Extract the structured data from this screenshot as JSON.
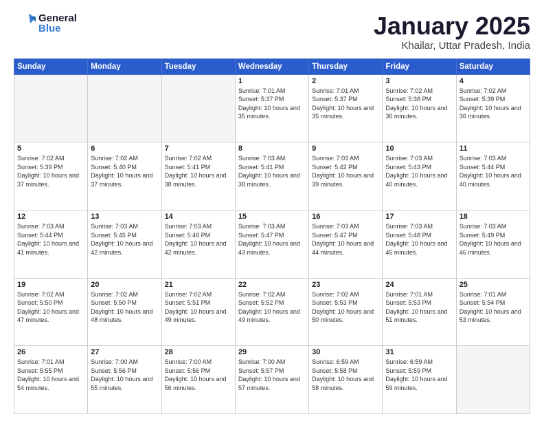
{
  "header": {
    "logo_general": "General",
    "logo_blue": "Blue",
    "title": "January 2025",
    "subtitle": "Khailar, Uttar Pradesh, India"
  },
  "weekdays": [
    "Sunday",
    "Monday",
    "Tuesday",
    "Wednesday",
    "Thursday",
    "Friday",
    "Saturday"
  ],
  "weeks": [
    [
      {
        "day": "",
        "empty": true
      },
      {
        "day": "",
        "empty": true
      },
      {
        "day": "",
        "empty": true
      },
      {
        "day": "1",
        "sunrise": "7:01 AM",
        "sunset": "5:37 PM",
        "daylight": "10 hours and 35 minutes."
      },
      {
        "day": "2",
        "sunrise": "7:01 AM",
        "sunset": "5:37 PM",
        "daylight": "10 hours and 35 minutes."
      },
      {
        "day": "3",
        "sunrise": "7:02 AM",
        "sunset": "5:38 PM",
        "daylight": "10 hours and 36 minutes."
      },
      {
        "day": "4",
        "sunrise": "7:02 AM",
        "sunset": "5:39 PM",
        "daylight": "10 hours and 36 minutes."
      }
    ],
    [
      {
        "day": "5",
        "sunrise": "7:02 AM",
        "sunset": "5:39 PM",
        "daylight": "10 hours and 37 minutes."
      },
      {
        "day": "6",
        "sunrise": "7:02 AM",
        "sunset": "5:40 PM",
        "daylight": "10 hours and 37 minutes."
      },
      {
        "day": "7",
        "sunrise": "7:02 AM",
        "sunset": "5:41 PM",
        "daylight": "10 hours and 38 minutes."
      },
      {
        "day": "8",
        "sunrise": "7:03 AM",
        "sunset": "5:41 PM",
        "daylight": "10 hours and 38 minutes."
      },
      {
        "day": "9",
        "sunrise": "7:03 AM",
        "sunset": "5:42 PM",
        "daylight": "10 hours and 39 minutes."
      },
      {
        "day": "10",
        "sunrise": "7:03 AM",
        "sunset": "5:43 PM",
        "daylight": "10 hours and 40 minutes."
      },
      {
        "day": "11",
        "sunrise": "7:03 AM",
        "sunset": "5:44 PM",
        "daylight": "10 hours and 40 minutes."
      }
    ],
    [
      {
        "day": "12",
        "sunrise": "7:03 AM",
        "sunset": "5:44 PM",
        "daylight": "10 hours and 41 minutes."
      },
      {
        "day": "13",
        "sunrise": "7:03 AM",
        "sunset": "5:45 PM",
        "daylight": "10 hours and 42 minutes."
      },
      {
        "day": "14",
        "sunrise": "7:03 AM",
        "sunset": "5:46 PM",
        "daylight": "10 hours and 42 minutes."
      },
      {
        "day": "15",
        "sunrise": "7:03 AM",
        "sunset": "5:47 PM",
        "daylight": "10 hours and 43 minutes."
      },
      {
        "day": "16",
        "sunrise": "7:03 AM",
        "sunset": "5:47 PM",
        "daylight": "10 hours and 44 minutes."
      },
      {
        "day": "17",
        "sunrise": "7:03 AM",
        "sunset": "5:48 PM",
        "daylight": "10 hours and 45 minutes."
      },
      {
        "day": "18",
        "sunrise": "7:03 AM",
        "sunset": "5:49 PM",
        "daylight": "10 hours and 46 minutes."
      }
    ],
    [
      {
        "day": "19",
        "sunrise": "7:02 AM",
        "sunset": "5:50 PM",
        "daylight": "10 hours and 47 minutes."
      },
      {
        "day": "20",
        "sunrise": "7:02 AM",
        "sunset": "5:50 PM",
        "daylight": "10 hours and 48 minutes."
      },
      {
        "day": "21",
        "sunrise": "7:02 AM",
        "sunset": "5:51 PM",
        "daylight": "10 hours and 49 minutes."
      },
      {
        "day": "22",
        "sunrise": "7:02 AM",
        "sunset": "5:52 PM",
        "daylight": "10 hours and 49 minutes."
      },
      {
        "day": "23",
        "sunrise": "7:02 AM",
        "sunset": "5:53 PM",
        "daylight": "10 hours and 50 minutes."
      },
      {
        "day": "24",
        "sunrise": "7:01 AM",
        "sunset": "5:53 PM",
        "daylight": "10 hours and 51 minutes."
      },
      {
        "day": "25",
        "sunrise": "7:01 AM",
        "sunset": "5:54 PM",
        "daylight": "10 hours and 53 minutes."
      }
    ],
    [
      {
        "day": "26",
        "sunrise": "7:01 AM",
        "sunset": "5:55 PM",
        "daylight": "10 hours and 54 minutes."
      },
      {
        "day": "27",
        "sunrise": "7:00 AM",
        "sunset": "5:56 PM",
        "daylight": "10 hours and 55 minutes."
      },
      {
        "day": "28",
        "sunrise": "7:00 AM",
        "sunset": "5:56 PM",
        "daylight": "10 hours and 56 minutes."
      },
      {
        "day": "29",
        "sunrise": "7:00 AM",
        "sunset": "5:57 PM",
        "daylight": "10 hours and 57 minutes."
      },
      {
        "day": "30",
        "sunrise": "6:59 AM",
        "sunset": "5:58 PM",
        "daylight": "10 hours and 58 minutes."
      },
      {
        "day": "31",
        "sunrise": "6:59 AM",
        "sunset": "5:59 PM",
        "daylight": "10 hours and 59 minutes."
      },
      {
        "day": "",
        "empty": true
      }
    ]
  ],
  "labels": {
    "sunrise": "Sunrise:",
    "sunset": "Sunset:",
    "daylight": "Daylight:"
  }
}
